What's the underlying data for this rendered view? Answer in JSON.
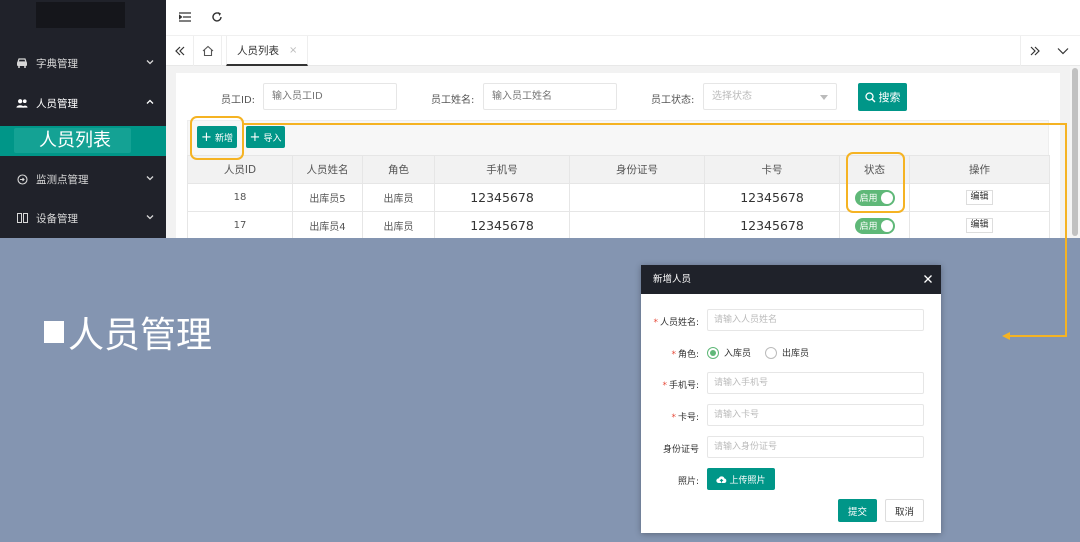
{
  "sidebar": {
    "items": [
      {
        "label": "字典管理",
        "icon": "car-icon"
      },
      {
        "label": "人员管理",
        "icon": "users-icon"
      },
      {
        "label": "监测点管理",
        "icon": "login-icon"
      },
      {
        "label": "设备管理",
        "icon": "columns-icon"
      }
    ],
    "selected_subitem": "人员列表"
  },
  "tabs": {
    "active_tab": "人员列表",
    "close_glyph": "×"
  },
  "filters": {
    "employee_id_label": "员工ID:",
    "employee_id_placeholder": "输入员工ID",
    "employee_name_label": "员工姓名:",
    "employee_name_placeholder": "输入员工姓名",
    "employee_status_label": "员工状态:",
    "employee_status_placeholder": "选择状态",
    "search_label": "搜索"
  },
  "toolbar": {
    "add_label": "新增",
    "import_label": "导入"
  },
  "table": {
    "columns": [
      "人员ID",
      "人员姓名",
      "角色",
      "手机号",
      "身份证号",
      "卡号",
      "状态",
      "操作"
    ],
    "rows": [
      {
        "id": "18",
        "name": "出库员5",
        "role": "出库员",
        "phone": "12345678",
        "idcard": "",
        "card": "12345678",
        "status": "启用",
        "action": "编辑"
      },
      {
        "id": "17",
        "name": "出库员4",
        "role": "出库员",
        "phone": "12345678",
        "idcard": "",
        "card": "12345678",
        "status": "启用",
        "action": "编辑"
      }
    ]
  },
  "overlay": {
    "title": "人员管理",
    "accent_color": "#f5b323",
    "background_color": "#8495b1"
  },
  "dialog": {
    "title": "新增人员",
    "close_glyph": "×",
    "name_label": "人员姓名:",
    "name_placeholder": "请输入人员姓名",
    "role_label": "角色:",
    "role_options": [
      "入库员",
      "出库员"
    ],
    "role_selected": "入库员",
    "phone_label": "手机号:",
    "phone_placeholder": "请输入手机号",
    "card_label": "卡号:",
    "card_placeholder": "请输入卡号",
    "idcard_label": "身份证号",
    "idcard_placeholder": "请输入身份证号",
    "photo_label": "照片:",
    "upload_label": "上传照片",
    "submit_label": "提交",
    "cancel_label": "取消",
    "required_mark": "*"
  },
  "colors": {
    "primary": "#009688",
    "switch_on": "#5fb878",
    "sidebar_bg": "#20222a"
  }
}
